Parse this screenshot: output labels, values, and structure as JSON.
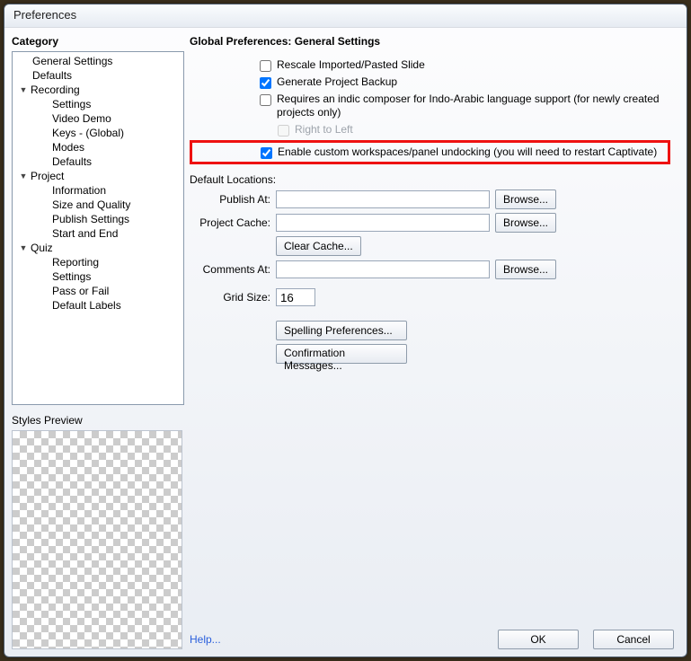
{
  "window": {
    "title": "Preferences"
  },
  "sidebar": {
    "heading": "Category",
    "items": [
      {
        "label": "General Settings",
        "level": 1
      },
      {
        "label": "Defaults",
        "level": 1
      },
      {
        "label": "Recording",
        "level": 1,
        "expandable": true
      },
      {
        "label": "Settings",
        "level": 2
      },
      {
        "label": "Video Demo",
        "level": 2
      },
      {
        "label": "Keys - (Global)",
        "level": 2
      },
      {
        "label": "Modes",
        "level": 2
      },
      {
        "label": "Defaults",
        "level": 2
      },
      {
        "label": "Project",
        "level": 1,
        "expandable": true
      },
      {
        "label": "Information",
        "level": 2
      },
      {
        "label": "Size and Quality",
        "level": 2
      },
      {
        "label": "Publish Settings",
        "level": 2
      },
      {
        "label": "Start and End",
        "level": 2
      },
      {
        "label": "Quiz",
        "level": 1,
        "expandable": true
      },
      {
        "label": "Reporting",
        "level": 2
      },
      {
        "label": "Settings",
        "level": 2
      },
      {
        "label": "Pass or Fail",
        "level": 2
      },
      {
        "label": "Default Labels",
        "level": 2
      }
    ],
    "stylesPreview": "Styles Preview"
  },
  "main": {
    "heading": "Global Preferences: General Settings",
    "checkboxes": {
      "rescale": "Rescale Imported/Pasted Slide",
      "backup": "Generate Project Backup",
      "indic": "Requires an indic composer for Indo-Arabic language support (for newly created projects only)",
      "rtl": "Right to Left",
      "workspaces": "Enable custom workspaces/panel undocking (you will need to restart Captivate)"
    },
    "defaultsHeading": "Default Locations:",
    "fields": {
      "publishLabel": "Publish At:",
      "cacheLabel": "Project Cache:",
      "commentsLabel": "Comments At:",
      "gridLabel": "Grid Size:",
      "gridValue": "16"
    },
    "buttons": {
      "browse": "Browse...",
      "clearCache": "Clear Cache...",
      "spelling": "Spelling Preferences...",
      "confirm": "Confirmation Messages..."
    }
  },
  "footer": {
    "help": "Help...",
    "ok": "OK",
    "cancel": "Cancel"
  }
}
